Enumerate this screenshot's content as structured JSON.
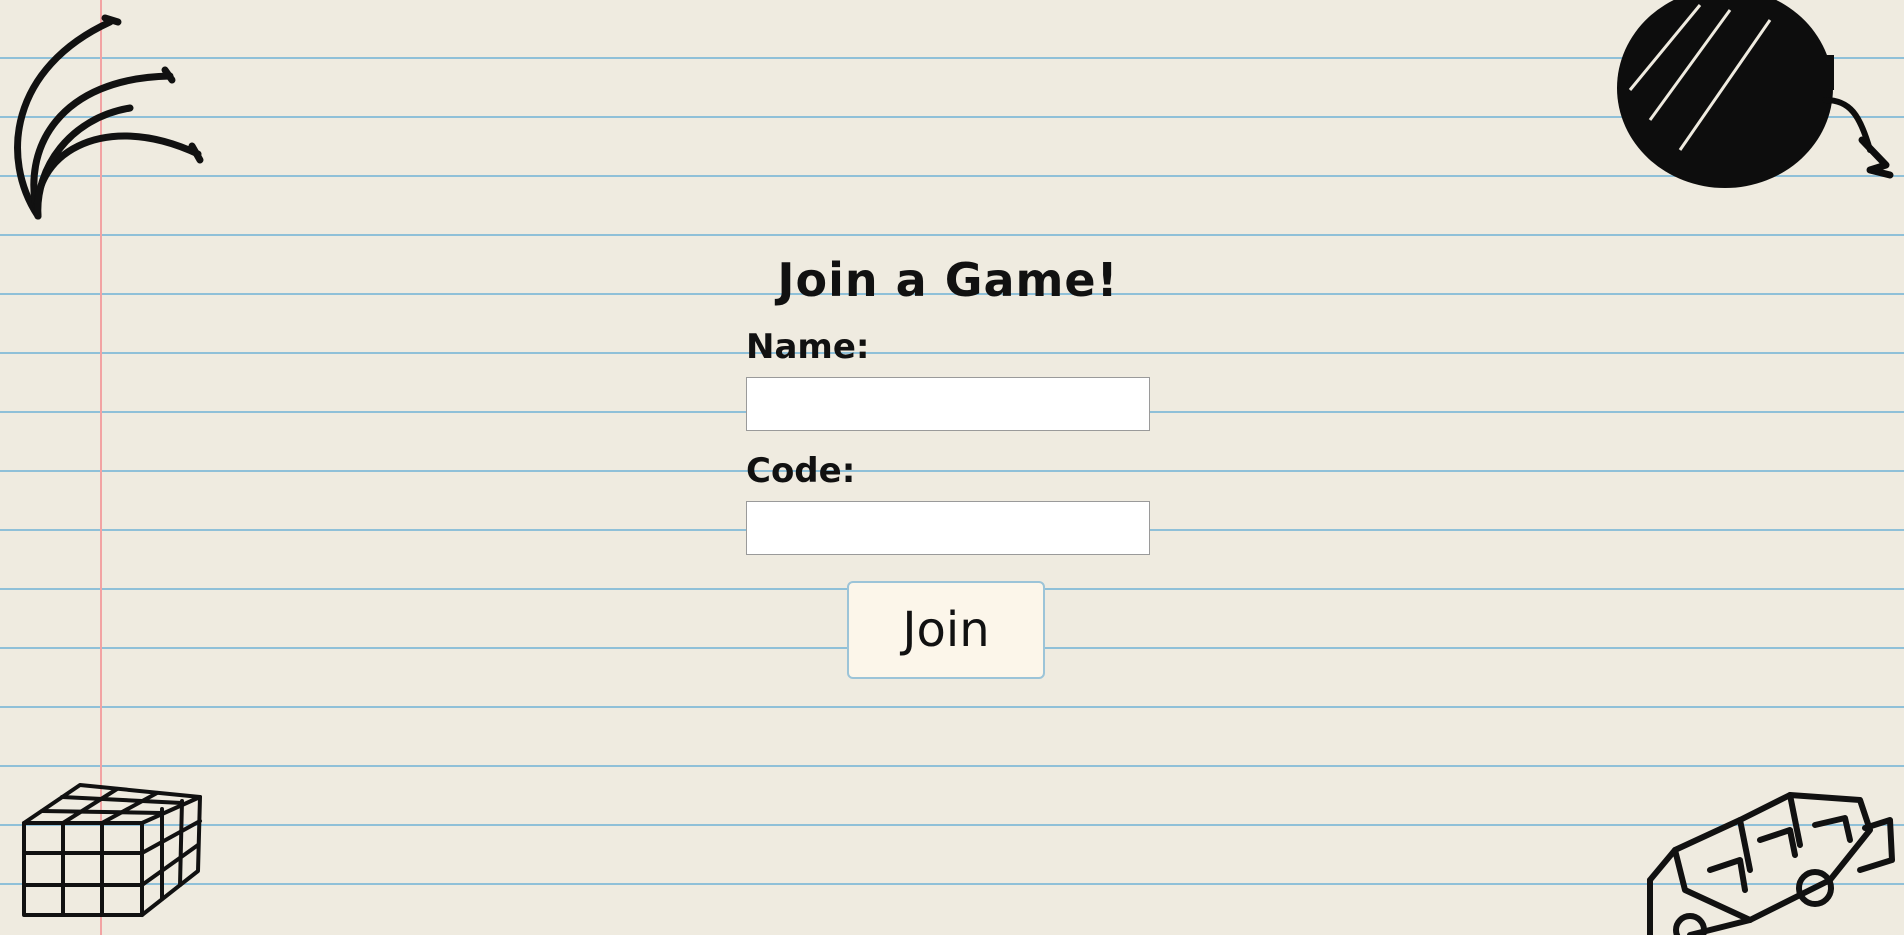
{
  "form": {
    "title": "Join a Game!",
    "name_label": "Name:",
    "name_value": "",
    "code_label": "Code:",
    "code_value": "",
    "join_label": "Join"
  },
  "doodles": [
    "banana-icon",
    "bomb-icon",
    "rubiks-cube-icon",
    "jeep-icon"
  ],
  "colors": {
    "paper": "#efebe0",
    "ruled_line": "#8fc0d8",
    "margin_line": "#f2a3a3",
    "button_border": "#9cc4d8",
    "button_bg": "#fcf6ea"
  }
}
